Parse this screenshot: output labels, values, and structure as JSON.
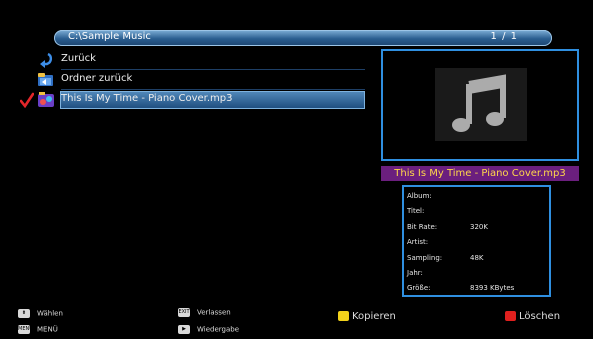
{
  "path_bar": {
    "path": "C:\\Sample Music",
    "page": "1 / 1"
  },
  "file_list": [
    {
      "label": "Zurück",
      "icon": "back-arrow-icon",
      "checked": false,
      "selected": false
    },
    {
      "label": "Ordner zurück",
      "icon": "folder-back-icon",
      "checked": false,
      "selected": false
    },
    {
      "label": "This Is My Time - Piano Cover.mp3",
      "icon": "music-file-icon",
      "checked": true,
      "selected": true
    }
  ],
  "preview": {
    "icon": "music-note-icon",
    "filename": "This Is My Time - Piano Cover.mp3"
  },
  "info": {
    "album_label": "Album:",
    "album_value": "",
    "title_label": "Titel:",
    "title_value": "",
    "bitrate_label": "Bit Rate:",
    "bitrate_value": "320K",
    "artist_label": "Artist:",
    "artist_value": "",
    "sampling_label": "Sampling:",
    "sampling_value": "48K",
    "year_label": "Jahr:",
    "year_value": "",
    "size_label": "Größe:",
    "size_value": "8393 KBytes"
  },
  "footer": {
    "select_label": "Wählen",
    "menu_key": "MENU",
    "menu_label": "MENÜ",
    "exit_key": "EXIT",
    "exit_label": "Verlassen",
    "play_label": "Wiedergabe",
    "copy_label": "Kopieren",
    "delete_label": "Löschen"
  },
  "colors": {
    "accent": "#2f8fe0",
    "filename_bar": "#6b1f7e",
    "filename_text": "#ffd84a",
    "copy_key": "#f2d21b",
    "delete_key": "#e0201e",
    "check": "#e3262a"
  }
}
